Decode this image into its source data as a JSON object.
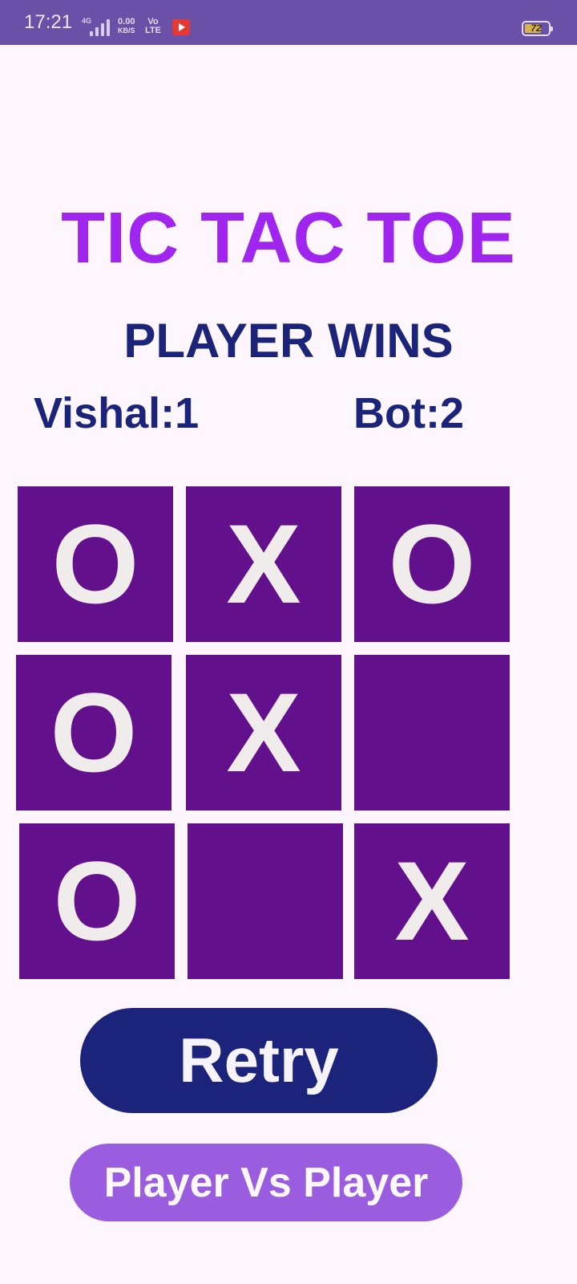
{
  "status_bar": {
    "time": "17:21",
    "network": "4G",
    "speed_value": "0.00",
    "speed_unit": "KB/S",
    "volte_top": "Vo",
    "volte_bottom": "LTE",
    "battery_level": "72",
    "battery_fraction": 0.72,
    "notification_icon": "youtube-icon"
  },
  "game": {
    "title": "TIC TAC TOE",
    "result_text": "PLAYER WINS",
    "player_score": "Vishal:1",
    "bot_score": "Bot:2",
    "board": [
      "O",
      "X",
      "O",
      "O",
      "X",
      "",
      "O",
      "",
      "X"
    ]
  },
  "buttons": {
    "retry_label": "Retry",
    "mode_label": "Player Vs Player"
  },
  "colors": {
    "status_bar": "#6a50a7",
    "title": "#a025ee",
    "text_dark": "#1b2479",
    "cell": "#63108d",
    "cell_mark": "#f1ecec",
    "retry_button": "#1b237a",
    "mode_button": "#9a5de0",
    "background": "#fdf7fd"
  }
}
